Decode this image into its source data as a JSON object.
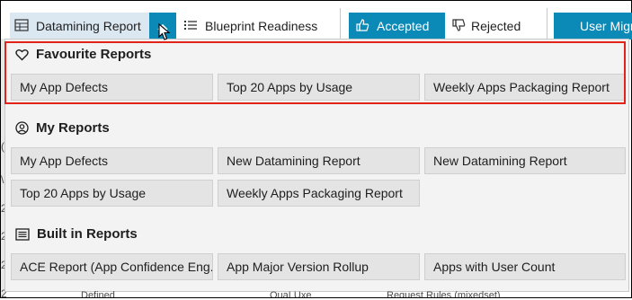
{
  "toolbar": {
    "datamining_label": "Datamining Report",
    "blueprint_label": "Blueprint Readiness",
    "accepted_label": "Accepted",
    "rejected_label": "Rejected",
    "user_migration_label": "User Migr"
  },
  "sections": {
    "favourites": {
      "title": "Favourite Reports",
      "icon": "heart-outline-icon",
      "items": [
        "My App Defects",
        "Top 20 Apps by Usage",
        "Weekly Apps Packaging Report"
      ]
    },
    "my_reports": {
      "title": "My Reports",
      "icon": "user-circle-icon",
      "items": [
        "My App Defects",
        "New Datamining Report",
        "New Datamining Report",
        "Top 20 Apps by Usage",
        "Weekly Apps Packaging Report"
      ]
    },
    "built_in": {
      "title": "Built in Reports",
      "icon": "list-box-icon",
      "items": [
        "ACE Report (App Confidence Eng...",
        "App Major Version Rollup",
        "Apps with User Count"
      ]
    }
  },
  "background_peek": {
    "left_chars": [
      "(",
      "\\",
      "2",
      "2",
      "2",
      "2"
    ],
    "bottom_texts": [
      "Defined",
      "QuaLUxe",
      "Request Rules (mixedset)"
    ]
  },
  "colors": {
    "accent": "#0c8ab7",
    "highlight": "#e2231a",
    "tile_bg": "#e4e4e4",
    "panel_bg": "#f3f3f3"
  }
}
